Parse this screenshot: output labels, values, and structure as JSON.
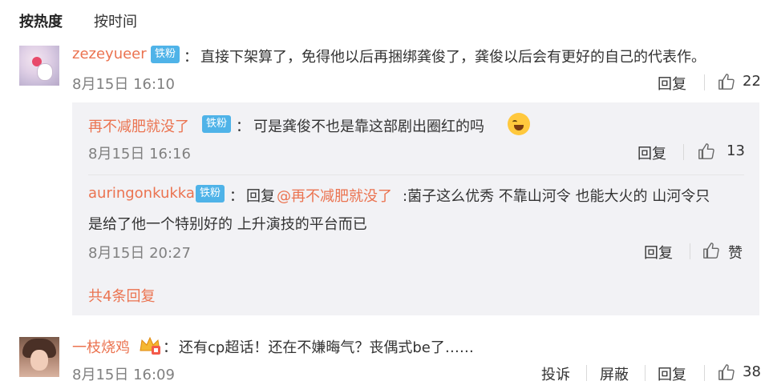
{
  "tabs": {
    "hot": "按热度",
    "time": "按时间"
  },
  "comment1": {
    "username": "zezeyueer",
    "badge": "铁粉",
    "colon": "：",
    "text": "直接下架算了，免得他以后再捆绑龚俊了，龚俊以后会有更好的自己的代表作。",
    "time": "8月15日 16:10",
    "reply_label": "回复",
    "likes": "22"
  },
  "reply1": {
    "username": "再不减肥就没了",
    "badge": "铁粉",
    "colon": "：",
    "text": "可是龚俊不也是靠这部剧出圈红的吗",
    "time": "8月15日 16:16",
    "reply_label": "回复",
    "likes": "13"
  },
  "reply2": {
    "username": "auringonkukka",
    "badge": "铁粉",
    "colon": "：",
    "prefix": "回复",
    "mention": "@再不减肥就没了",
    "text_line1": ":菌子这么优秀 不靠山河令 也能大火的 山河令只",
    "text_line2": "是给了他一个特别好的 上升演技的平台而已",
    "time": "8月15日 20:27",
    "reply_label": "回复",
    "like_label": "赞"
  },
  "more_replies": "共4条回复",
  "comment2": {
    "username": "一枝烧鸡",
    "colon": "：",
    "text": "还有cp超话！还在不嫌晦气？丧偶式be了……",
    "time": "8月15日 16:09",
    "report_label": "投诉",
    "block_label": "屏蔽",
    "reply_label": "回复",
    "likes": "38"
  },
  "colors": {
    "username": "#eb7350",
    "badge": "#4fb3e8",
    "reply_bg": "#f2f2f5",
    "meta": "#808080"
  },
  "icons": {
    "like": "thumbs-up-icon",
    "emoji": "laugh-cry-emoji-icon",
    "crown": "crown-badge-icon"
  }
}
